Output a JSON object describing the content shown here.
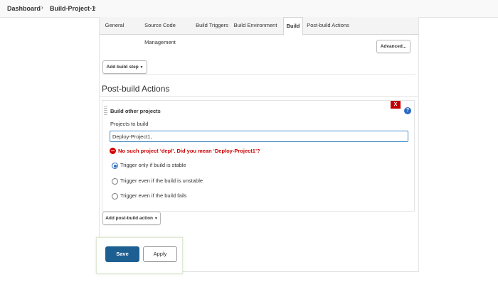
{
  "breadcrumb": {
    "items": [
      "Dashboard",
      "Build-Project-1"
    ],
    "separator": "›"
  },
  "tabs": [
    {
      "label": "General"
    },
    {
      "label": "Source Code Management"
    },
    {
      "label": "Build Triggers"
    },
    {
      "label": "Build Environment"
    },
    {
      "label": "Build",
      "active": true
    },
    {
      "label": "Post-build Actions"
    }
  ],
  "build": {
    "advanced_label": "Advanced...",
    "add_build_step_label": "Add build step"
  },
  "post_build": {
    "section_title": "Post-build Actions",
    "block_title": "Build other projects",
    "delete_label": "X",
    "help_label": "?",
    "projects_label": "Projects to build",
    "projects_value": "Deploy-Project1,",
    "error_message": "No such project ‘depl’. Did you mean ‘Deploy-Project1’?",
    "options": [
      {
        "label": "Trigger only if build is stable",
        "checked": true
      },
      {
        "label": "Trigger even if the build is unstable",
        "checked": false
      },
      {
        "label": "Trigger even if the build fails",
        "checked": false
      }
    ],
    "add_action_label": "Add post-build action"
  },
  "actions": {
    "save_label": "Save",
    "apply_label": "Apply"
  },
  "colors": {
    "accent": "#1e5f92",
    "error": "#cc0000",
    "delete": "#c30000",
    "help": "#2a6ac2"
  }
}
